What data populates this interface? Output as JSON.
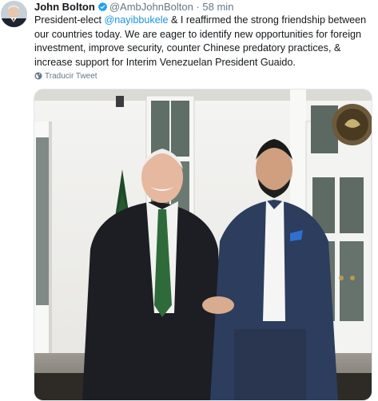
{
  "tweet": {
    "author_name": "John Bolton",
    "handle": "@AmbJohnBolton",
    "separator": "·",
    "time": "58 min",
    "text_segments": [
      {
        "text": "President-elect ",
        "mention": false
      },
      {
        "text": "@nayibbukele",
        "mention": true
      },
      {
        "text": " & I reaffirmed the strong friendship between our countries today. We are eager to identify new opportunities for foreign investment, improve security, counter Chinese predatory practices, & increase support for Interim Venezuelan President Guaido.",
        "mention": false
      }
    ],
    "translate_label": "Traducir Tweet",
    "icons": {
      "verified": "verified-badge-icon",
      "translate": "globe-icon"
    }
  },
  "colors": {
    "mention": "#1b95e0",
    "verified": "#1da1f2",
    "secondary_text": "#657786",
    "primary_text": "#14171a"
  }
}
